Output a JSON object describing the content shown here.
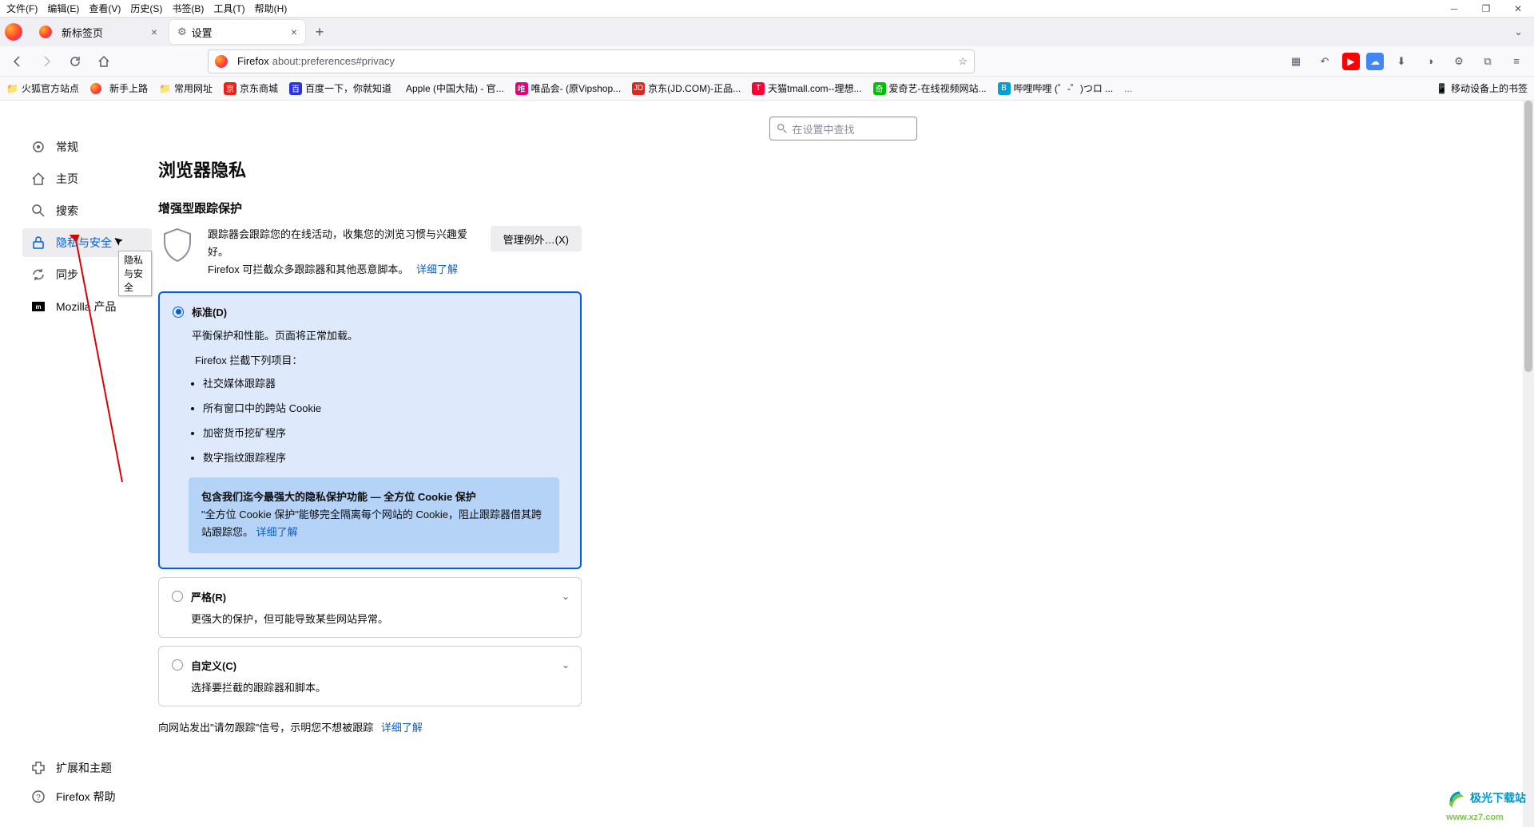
{
  "menu": [
    "文件(F)",
    "编辑(E)",
    "查看(V)",
    "历史(S)",
    "书签(B)",
    "工具(T)",
    "帮助(H)"
  ],
  "tabs": {
    "tab1": "新标签页",
    "tab2": "设置"
  },
  "url": {
    "prefix": "Firefox",
    "path": "about:preferences#privacy"
  },
  "bookmarks": {
    "b1": "火狐官方站点",
    "b2": "新手上路",
    "b3": "常用网址",
    "b4": "京东商城",
    "b5": "百度一下，你就知道",
    "b6": "Apple (中国大陆) - 官...",
    "b7": "唯品会- (原Vipshop...",
    "b8": "京东(JD.COM)-正品...",
    "b9": "天猫tmall.com--理想...",
    "b10": "爱奇艺-在线视频网站...",
    "b11": "哔哩哔哩 (゜-゜)つロ ...",
    "mobile": "移动设备上的书签"
  },
  "search": {
    "placeholder": "在设置中查找"
  },
  "sidebar": {
    "general": "常规",
    "home": "主页",
    "search": "搜索",
    "privacy": "隐私与安全",
    "sync": "同步",
    "mozilla": "Mozilla 产品",
    "extensions": "扩展和主题",
    "help": "Firefox 帮助"
  },
  "tooltip": "隐私与安全",
  "page": {
    "title": "浏览器隐私",
    "etp_heading": "增强型跟踪保护",
    "etp_desc1": "跟踪器会跟踪您的在线活动，收集您的浏览习惯与兴趣爱好。",
    "etp_desc2": "Firefox 可拦截众多跟踪器和其他恶意脚本。",
    "learn_more": "详细了解",
    "manage_btn": "管理例外…(X)",
    "standard": {
      "title": "标准(D)",
      "desc": "平衡保护和性能。页面将正常加载。",
      "blocks_label": "Firefox 拦截下列项目：",
      "items": [
        "社交媒体跟踪器",
        "所有窗口中的跨站 Cookie",
        "加密货币挖矿程序",
        "数字指纹跟踪程序"
      ],
      "info_title": "包含我们迄今最强大的隐私保护功能 — 全方位 Cookie 保护",
      "info_desc": "\"全方位 Cookie 保护\"能够完全隔离每个网站的 Cookie，阻止跟踪器借其跨站跟踪您。",
      "info_link": "详细了解"
    },
    "strict": {
      "title": "严格(R)",
      "desc": "更强大的保护，但可能导致某些网站异常。"
    },
    "custom": {
      "title": "自定义(C)",
      "desc": "选择要拦截的跟踪器和脚本。"
    },
    "dnt": "向网站发出\"请勿跟踪\"信号，示明您不想被跟踪",
    "dnt_link": "详细了解"
  },
  "watermark": {
    "line1": "极光下载站",
    "line2": "www.xz7.com"
  }
}
